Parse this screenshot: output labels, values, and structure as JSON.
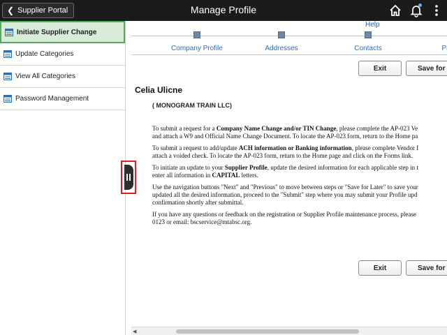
{
  "header": {
    "back_label": "Supplier Portal",
    "title": "Manage Profile",
    "icons": [
      "home-icon",
      "bell-icon",
      "kebab-menu-icon"
    ]
  },
  "sidebar": {
    "items": [
      {
        "label": "Initiate Supplier Change",
        "active": true
      },
      {
        "label": "Update Categories",
        "active": false
      },
      {
        "label": "View All Categories",
        "active": false
      },
      {
        "label": "Password Management",
        "active": false
      }
    ]
  },
  "main": {
    "help": "Help",
    "steps": [
      "Company Profile",
      "Addresses",
      "Contacts",
      "Payme"
    ],
    "exit_label": "Exit",
    "save_label": "Save for L",
    "supplier_name": "Celia Ulicne",
    "company": "( MONOGRAM TRAIN LLC)",
    "paragraphs": [
      {
        "l1a": "To submit a request for a ",
        "l1b": "Company Name Change and/or TIN Change",
        "l1c": ", please complete the AP-023 Ve",
        "l2": "and attach a W9 and Official Name Change Document.  To locate the AP-023 form, return to the Home pa"
      },
      {
        "l1a": "To submit a request to add/update ",
        "l1b": "ACH information or Banking information",
        "l1c": ", please complete Vendor I",
        "l2": "attach a voided check. To locate the AP-023 form, return to the Home page and click on the Forms link."
      },
      {
        "l1a": "To initiate an update to your ",
        "l1b": "Supplier Profile",
        "l1c": ", update the desired information for each applicable step in t",
        "l2a": "enter all information in ",
        "l2b": "CAPITAL",
        "l2c": " letters."
      },
      {
        "l1": "Use the navigation buttons \"Next\" and \"Previous\" to move between steps or \"Save for Later\" to save your",
        "l2": "updated all the desired information, proceed to the \"Submit\" step where you may submit your Profile upd",
        "l3": "confirmation shortly after submittal."
      },
      {
        "l1": "If you have any questions or feedback on the registration or Supplier Profile maintenance process, please",
        "l2": "0123 or email: bscservice@mtabsc.org."
      }
    ]
  },
  "colors": {
    "header_bg": "#1b1b1b",
    "active_item_bg": "#d8ecd8",
    "active_item_border": "#4fae5a",
    "link": "#2e6eb8",
    "highlight_frame": "#e31b23"
  }
}
